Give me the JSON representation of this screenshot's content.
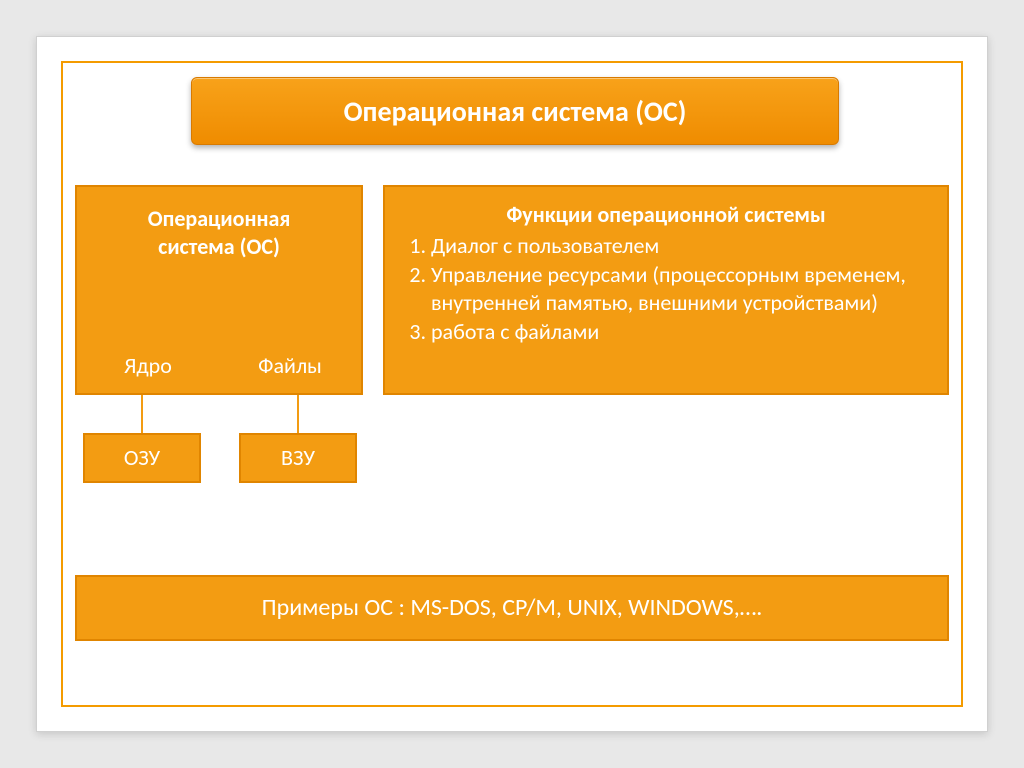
{
  "title": "Операционная система (ОС)",
  "os": {
    "heading_line1": "Операционная",
    "heading_line2": "система (ОС)",
    "child_left": "Ядро",
    "child_right": "Файлы"
  },
  "memory": {
    "ram": "ОЗУ",
    "ext": "ВЗУ"
  },
  "functions": {
    "title": "Функции операционной системы",
    "items": [
      "Диалог с пользователем",
      " Управление ресурсами (процессорным временем, внутренней памятью, внешними устройствами)",
      " работа с файлами"
    ]
  },
  "examples": "Примеры ОС : MS-DOS, CP/M, UNIX, WINDOWS,…."
}
